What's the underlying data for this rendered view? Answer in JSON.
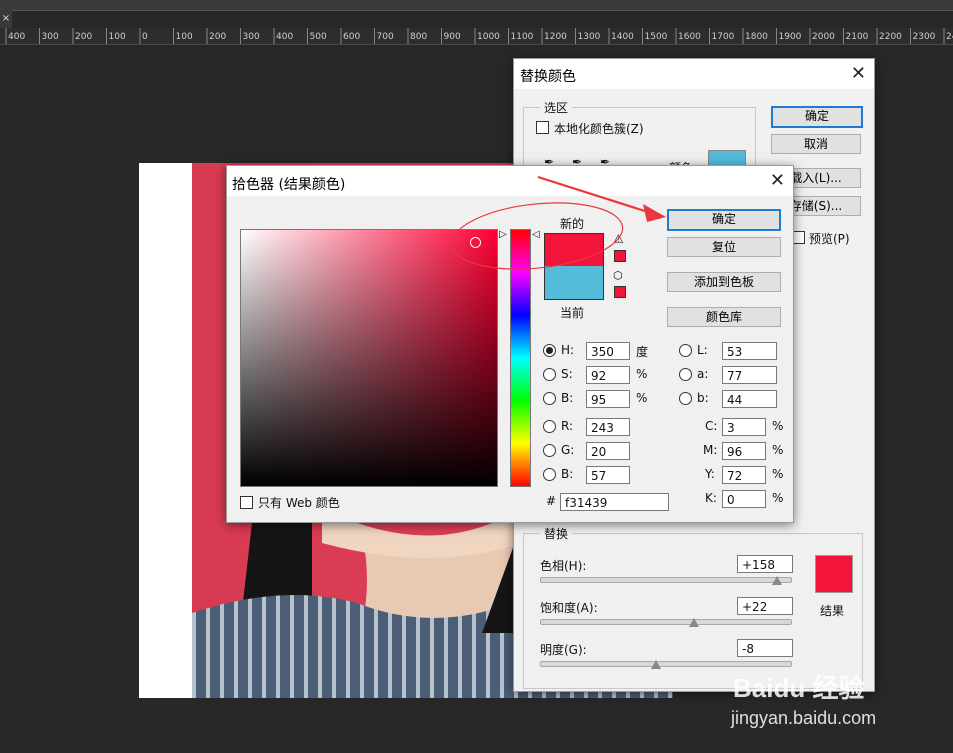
{
  "ruler": {
    "ticks": [
      "400",
      "300",
      "200",
      "100",
      "0",
      "100",
      "200",
      "300",
      "400",
      "500",
      "600",
      "700",
      "800",
      "900",
      "1000",
      "1100",
      "1200",
      "1300",
      "1400",
      "1500",
      "1600",
      "1700",
      "1800",
      "1900",
      "2000",
      "2100",
      "2200",
      "2300",
      "24"
    ]
  },
  "doc_tab_close": "×",
  "replace_dialog": {
    "title": "替换颜色",
    "selection_group": "选区",
    "localized_clusters_label": "本地化颜色簇(Z)",
    "color_label": "颜色:",
    "ok": "确定",
    "cancel": "取消",
    "load": "载入(L)...",
    "save": "存储(S)...",
    "preview": "预览(P)",
    "replace_group": "替换",
    "hue_label": "色相(H):",
    "hue_value": "+158",
    "saturation_label": "饱和度(A):",
    "saturation_value": "+22",
    "lightness_label": "明度(G):",
    "lightness_value": "-8",
    "result_label": "结果",
    "result_color": "#f31439",
    "sample_color": "#52bcd9"
  },
  "picker": {
    "title": "拾色器 (结果颜色)",
    "new_label": "新的",
    "current_label": "当前",
    "new_color": "#f31439",
    "current_color": "#52bcd9",
    "ok": "确定",
    "reset": "复位",
    "add_swatch": "添加到色板",
    "libraries": "颜色库",
    "web_only": "只有 Web 颜色",
    "h_label": "H:",
    "h_value": "350",
    "h_unit": "度",
    "s_label": "S:",
    "s_value": "92",
    "s_unit": "%",
    "b_label": "B:",
    "b_value": "95",
    "b_unit": "%",
    "r_label": "R:",
    "r_value": "243",
    "g_label": "G:",
    "g_value": "20",
    "bb_label": "B:",
    "bb_value": "57",
    "l_label": "L:",
    "l_value": "53",
    "a_label": "a:",
    "a_value": "77",
    "lab_b_label": "b:",
    "lab_b_value": "44",
    "c_label": "C:",
    "c_value": "3",
    "m_label": "M:",
    "m_value": "96",
    "y_label": "Y:",
    "y_value": "72",
    "k_label": "K:",
    "k_value": "0",
    "pct": "%",
    "hex_label": "#",
    "hex_value": "f31439",
    "field_hue": "#ff0033"
  },
  "watermark": {
    "brand": "Baidu 经验",
    "url": "jingyan.baidu.com"
  }
}
